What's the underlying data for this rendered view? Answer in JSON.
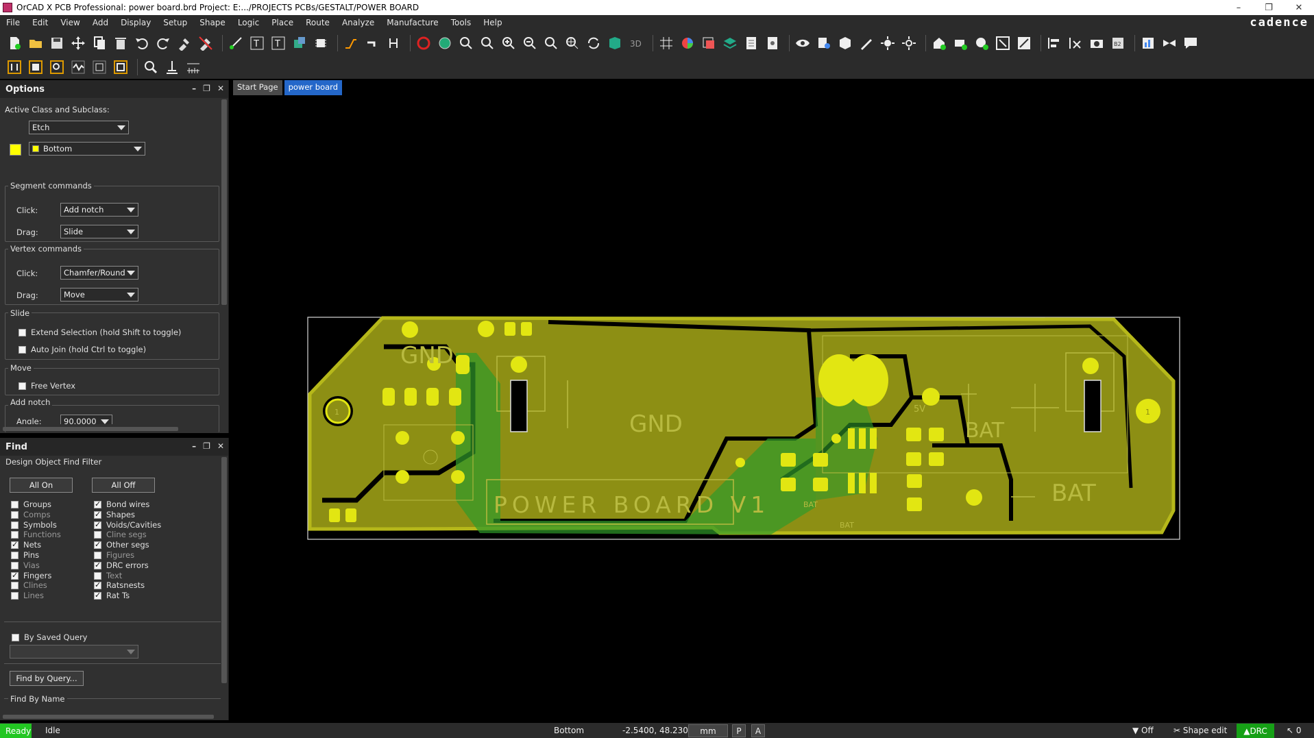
{
  "window": {
    "title": "OrCAD X PCB Professional: power board.brd  Project: E:.../PROJECTS PCBs/GESTALT/POWER BOARD",
    "controls": [
      "–",
      "❐",
      "✕"
    ]
  },
  "menu": {
    "items": [
      "File",
      "Edit",
      "View",
      "Add",
      "Display",
      "Setup",
      "Shape",
      "Logic",
      "Place",
      "Route",
      "Analyze",
      "Manufacture",
      "Tools",
      "Help"
    ],
    "brand": "cadence"
  },
  "options_panel": {
    "title": "Options",
    "active_class_label": "Active Class and Subclass:",
    "class_value": "Etch",
    "subclass_value": "Bottom",
    "segment_commands": {
      "title": "Segment commands",
      "click_label": "Click:",
      "click_value": "Add notch",
      "drag_label": "Drag:",
      "drag_value": "Slide"
    },
    "vertex_commands": {
      "title": "Vertex commands",
      "click_label": "Click:",
      "click_value": "Chamfer/Round",
      "drag_label": "Drag:",
      "drag_value": "Move"
    },
    "slide": {
      "title": "Slide",
      "extend_selection": "Extend Selection (hold Shift to toggle)",
      "auto_join": "Auto Join (hold Ctrl to toggle)"
    },
    "move": {
      "title": "Move",
      "free_vertex": "Free Vertex"
    },
    "add_notch": {
      "title": "Add notch",
      "angle_label": "Angle:",
      "angle_value": "90.0000"
    }
  },
  "find_panel": {
    "title": "Find",
    "filter_title": "Design Object Find Filter",
    "all_on": "All On",
    "all_off": "All Off",
    "left_filters": [
      {
        "label": "Groups",
        "checked": false,
        "dim": false
      },
      {
        "label": "Comps",
        "checked": false,
        "dim": true
      },
      {
        "label": "Symbols",
        "checked": false,
        "dim": false
      },
      {
        "label": "Functions",
        "checked": false,
        "dim": true
      },
      {
        "label": "Nets",
        "checked": true,
        "dim": false
      },
      {
        "label": "Pins",
        "checked": false,
        "dim": false
      },
      {
        "label": "Vias",
        "checked": false,
        "dim": true
      },
      {
        "label": "Fingers",
        "checked": true,
        "dim": false
      },
      {
        "label": "Clines",
        "checked": false,
        "dim": true
      },
      {
        "label": "Lines",
        "checked": false,
        "dim": true
      }
    ],
    "right_filters": [
      {
        "label": "Bond wires",
        "checked": true,
        "dim": false
      },
      {
        "label": "Shapes",
        "checked": true,
        "dim": false
      },
      {
        "label": "Voids/Cavities",
        "checked": true,
        "dim": false
      },
      {
        "label": "Cline segs",
        "checked": false,
        "dim": true
      },
      {
        "label": "Other segs",
        "checked": true,
        "dim": false
      },
      {
        "label": "Figures",
        "checked": false,
        "dim": true
      },
      {
        "label": "DRC errors",
        "checked": true,
        "dim": false
      },
      {
        "label": "Text",
        "checked": false,
        "dim": true
      },
      {
        "label": "Ratsnests",
        "checked": true,
        "dim": false
      },
      {
        "label": "Rat Ts",
        "checked": true,
        "dim": false
      }
    ],
    "by_saved_query": "By Saved Query",
    "find_by_query": "Find by Query...",
    "find_by_name": "Find By Name"
  },
  "tabs": [
    {
      "label": "Start Page",
      "active": false
    },
    {
      "label": "power board",
      "active": true
    }
  ],
  "board": {
    "labels": {
      "gnd_top": "GND",
      "gnd_center": "GND",
      "power_board": "POWER BOARD V1",
      "bat_right": "BAT",
      "bat_mid": "BAT",
      "v5": "5V",
      "bat_small1": "BAT",
      "bat_small2": "BAT",
      "one_left": "1",
      "one_right": "1"
    },
    "colors": {
      "copper": "#8d8f14",
      "copper_edge": "#b6b81a",
      "green_shape": "#2f9a2a",
      "pad": "#e2e612",
      "outline": "#d8d8d8"
    }
  },
  "statusbar": {
    "ready": "Ready",
    "state": "Idle",
    "layer": "Bottom",
    "coord": "-2.5400, 48.2300",
    "units": "mm",
    "p": "P",
    "a": "A",
    "filter": "Off",
    "mode": "Shape edit",
    "drc": "DRC",
    "selection_count": "0"
  },
  "colors": {
    "ready_bg": "#22c622",
    "tab_active": "#2467c9",
    "panel_bg": "#303030"
  }
}
